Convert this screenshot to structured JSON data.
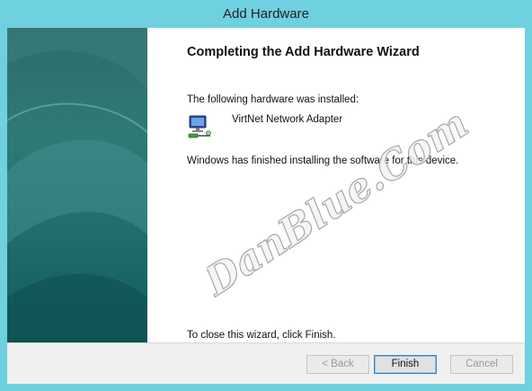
{
  "window": {
    "title": "Add Hardware"
  },
  "wizard": {
    "heading": "Completing the Add Hardware Wizard",
    "installed_label": "The following hardware was installed:",
    "device_name": "VirtNet Network Adapter",
    "device_icon": "network-adapter-icon",
    "finished_text": "Windows has finished installing the software for this device.",
    "close_text": "To close this wizard, click Finish."
  },
  "buttons": {
    "back": "< Back",
    "finish": "Finish",
    "cancel": "Cancel"
  },
  "watermark": {
    "text": "DanBlue.Com"
  },
  "colors": {
    "frame": "#6fd0df",
    "side_panel": "#2d7a76",
    "footer": "#f0f0f0"
  }
}
